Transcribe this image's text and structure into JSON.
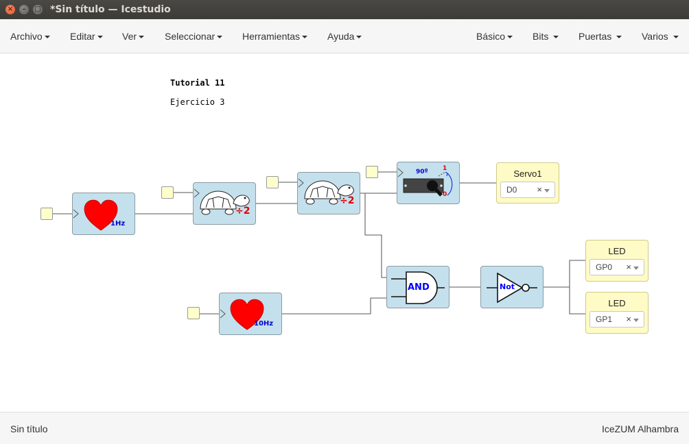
{
  "window": {
    "title": "*Sin título — Icestudio",
    "buttons": {
      "close": "×",
      "minimize": "–",
      "maximize": "□"
    }
  },
  "menu": {
    "left": [
      "Archivo",
      "Editar",
      "Ver",
      "Seleccionar",
      "Herramientas",
      "Ayuda"
    ],
    "right": [
      "Básico",
      "Bits",
      "Puertas",
      "Varios"
    ]
  },
  "canvas": {
    "notes": {
      "title": "Tutorial 11",
      "subtitle": "Ejercicio 3"
    },
    "blocks": {
      "heart1": {
        "freq_label": "1Hz",
        "icon": "heart-icon"
      },
      "heart10": {
        "freq_label": "10Hz",
        "icon": "heart-icon"
      },
      "prescaler1": {
        "div_label": "÷2",
        "icon": "turtle-icon"
      },
      "prescaler2": {
        "div_label": "÷2",
        "icon": "turtle-icon"
      },
      "servo": {
        "angle_label": "90º",
        "top_label": "1",
        "bottom_label": "0",
        "icon": "servo-icon"
      },
      "and_gate": {
        "label": "AND"
      },
      "not_gate": {
        "label": "Not"
      }
    },
    "outputs": [
      {
        "title": "Servo1",
        "value": "D0",
        "clear": "×"
      },
      {
        "title": "LED",
        "value": "GP0",
        "clear": "×"
      },
      {
        "title": "LED",
        "value": "GP1",
        "clear": "×"
      }
    ]
  },
  "status": {
    "left": "Sin título",
    "right": "IceZUM Alhambra"
  },
  "colors": {
    "titlebar": "#3c3b37",
    "block_fill": "#c4e0ec",
    "output_fill": "#fffbc6",
    "pin_fill": "#ffffcc",
    "heart": "#ff0000",
    "freq_text": "#0000cc",
    "div_text": "#e00000",
    "gate_text": "#0000ff"
  }
}
